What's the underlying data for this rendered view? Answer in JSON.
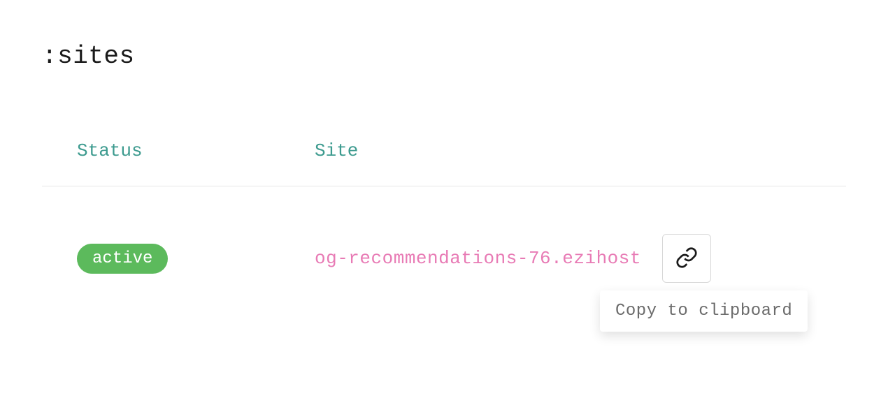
{
  "page": {
    "title": ":sites"
  },
  "table": {
    "headers": {
      "status": "Status",
      "site": "Site"
    },
    "rows": [
      {
        "status": "active",
        "site_url": "og-recommendations-76.ezihost"
      }
    ]
  },
  "tooltip": {
    "copy_text": "Copy to clipboard"
  },
  "colors": {
    "header_text": "#3d9b8f",
    "badge_bg": "#5cba5c",
    "link": "#e87bb5",
    "tooltip_text": "#6b6b6b"
  }
}
